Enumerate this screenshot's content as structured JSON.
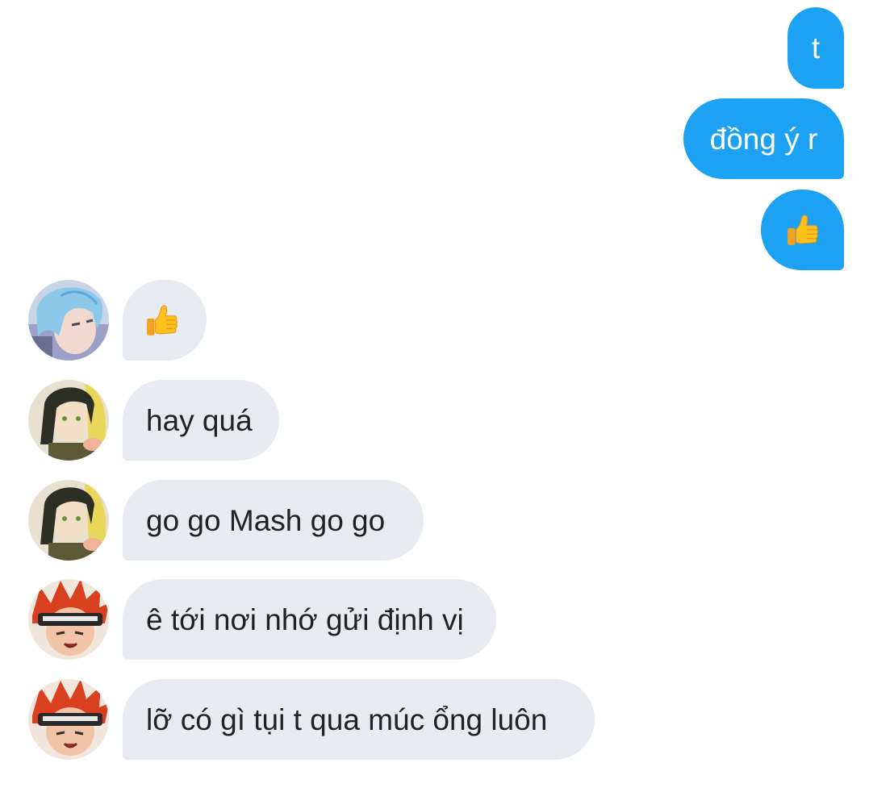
{
  "chat": {
    "outgoing": [
      {
        "text": "t"
      },
      {
        "text": "đồng ý r"
      },
      {
        "text": ""
      }
    ],
    "incoming": [
      {
        "text": "",
        "avatar": "blue-hair-avatar"
      },
      {
        "text": "hay quá",
        "avatar": "dark-hair-avatar"
      },
      {
        "text": "go go Mash go go",
        "avatar": "dark-hair-avatar"
      },
      {
        "text": "ê tới nơi nhớ gửi định vị",
        "avatar": "red-hair-avatar"
      },
      {
        "text": "lỡ có gì tụi t qua múc ổng luôn",
        "avatar": "red-hair-avatar"
      }
    ]
  },
  "icons": {
    "thumbs_up": "thumbs-up-icon"
  },
  "colors": {
    "outgoing_bubble": "#1da1f2",
    "incoming_bubble": "#e8ecf0",
    "outgoing_text": "#ffffff",
    "incoming_text": "#222222"
  }
}
